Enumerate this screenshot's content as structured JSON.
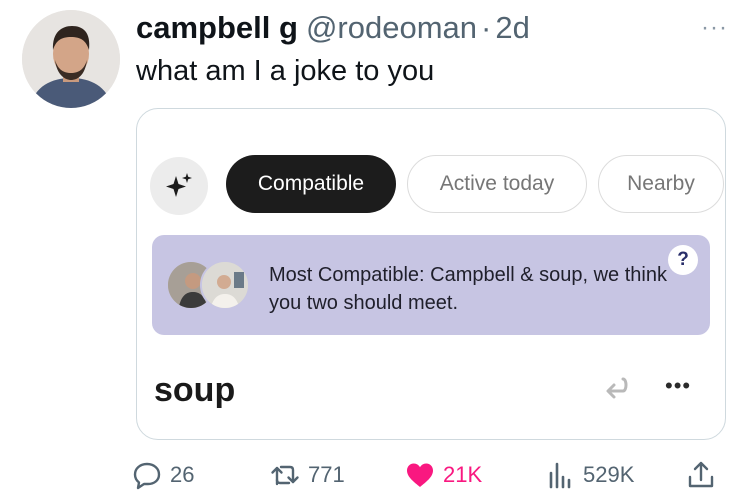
{
  "tweet": {
    "author_name": "campbell g",
    "author_handle": "@rodeoman",
    "separator": "·",
    "timestamp": "2d",
    "more_label": "···",
    "text": "what am I a joke to you"
  },
  "card": {
    "tabs": [
      {
        "label": "Compatible",
        "active": true
      },
      {
        "label": "Active today",
        "active": false
      },
      {
        "label": "Nearby",
        "active": false
      }
    ],
    "sparkle_icon": "sparkle-icon",
    "banner": {
      "text": "Most Compatible: Campbell & soup, we think you two should meet.",
      "help_label": "?",
      "color": "#c7c5e3"
    },
    "profile_name": "soup",
    "more_label": "•••"
  },
  "actions": {
    "replies": "26",
    "retweets": "771",
    "likes": "21K",
    "views": "529K",
    "like_color": "#f91880",
    "muted_color": "#536471"
  }
}
